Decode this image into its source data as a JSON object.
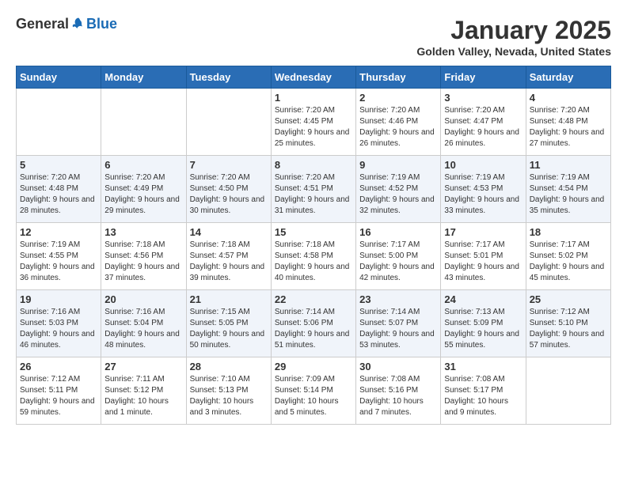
{
  "header": {
    "logo_general": "General",
    "logo_blue": "Blue",
    "title": "January 2025",
    "subtitle": "Golden Valley, Nevada, United States"
  },
  "weekdays": [
    "Sunday",
    "Monday",
    "Tuesday",
    "Wednesday",
    "Thursday",
    "Friday",
    "Saturday"
  ],
  "weeks": [
    [
      {
        "day": "",
        "sunrise": "",
        "sunset": "",
        "daylight": ""
      },
      {
        "day": "",
        "sunrise": "",
        "sunset": "",
        "daylight": ""
      },
      {
        "day": "",
        "sunrise": "",
        "sunset": "",
        "daylight": ""
      },
      {
        "day": "1",
        "sunrise": "Sunrise: 7:20 AM",
        "sunset": "Sunset: 4:45 PM",
        "daylight": "Daylight: 9 hours and 25 minutes."
      },
      {
        "day": "2",
        "sunrise": "Sunrise: 7:20 AM",
        "sunset": "Sunset: 4:46 PM",
        "daylight": "Daylight: 9 hours and 26 minutes."
      },
      {
        "day": "3",
        "sunrise": "Sunrise: 7:20 AM",
        "sunset": "Sunset: 4:47 PM",
        "daylight": "Daylight: 9 hours and 26 minutes."
      },
      {
        "day": "4",
        "sunrise": "Sunrise: 7:20 AM",
        "sunset": "Sunset: 4:48 PM",
        "daylight": "Daylight: 9 hours and 27 minutes."
      }
    ],
    [
      {
        "day": "5",
        "sunrise": "Sunrise: 7:20 AM",
        "sunset": "Sunset: 4:48 PM",
        "daylight": "Daylight: 9 hours and 28 minutes."
      },
      {
        "day": "6",
        "sunrise": "Sunrise: 7:20 AM",
        "sunset": "Sunset: 4:49 PM",
        "daylight": "Daylight: 9 hours and 29 minutes."
      },
      {
        "day": "7",
        "sunrise": "Sunrise: 7:20 AM",
        "sunset": "Sunset: 4:50 PM",
        "daylight": "Daylight: 9 hours and 30 minutes."
      },
      {
        "day": "8",
        "sunrise": "Sunrise: 7:20 AM",
        "sunset": "Sunset: 4:51 PM",
        "daylight": "Daylight: 9 hours and 31 minutes."
      },
      {
        "day": "9",
        "sunrise": "Sunrise: 7:19 AM",
        "sunset": "Sunset: 4:52 PM",
        "daylight": "Daylight: 9 hours and 32 minutes."
      },
      {
        "day": "10",
        "sunrise": "Sunrise: 7:19 AM",
        "sunset": "Sunset: 4:53 PM",
        "daylight": "Daylight: 9 hours and 33 minutes."
      },
      {
        "day": "11",
        "sunrise": "Sunrise: 7:19 AM",
        "sunset": "Sunset: 4:54 PM",
        "daylight": "Daylight: 9 hours and 35 minutes."
      }
    ],
    [
      {
        "day": "12",
        "sunrise": "Sunrise: 7:19 AM",
        "sunset": "Sunset: 4:55 PM",
        "daylight": "Daylight: 9 hours and 36 minutes."
      },
      {
        "day": "13",
        "sunrise": "Sunrise: 7:18 AM",
        "sunset": "Sunset: 4:56 PM",
        "daylight": "Daylight: 9 hours and 37 minutes."
      },
      {
        "day": "14",
        "sunrise": "Sunrise: 7:18 AM",
        "sunset": "Sunset: 4:57 PM",
        "daylight": "Daylight: 9 hours and 39 minutes."
      },
      {
        "day": "15",
        "sunrise": "Sunrise: 7:18 AM",
        "sunset": "Sunset: 4:58 PM",
        "daylight": "Daylight: 9 hours and 40 minutes."
      },
      {
        "day": "16",
        "sunrise": "Sunrise: 7:17 AM",
        "sunset": "Sunset: 5:00 PM",
        "daylight": "Daylight: 9 hours and 42 minutes."
      },
      {
        "day": "17",
        "sunrise": "Sunrise: 7:17 AM",
        "sunset": "Sunset: 5:01 PM",
        "daylight": "Daylight: 9 hours and 43 minutes."
      },
      {
        "day": "18",
        "sunrise": "Sunrise: 7:17 AM",
        "sunset": "Sunset: 5:02 PM",
        "daylight": "Daylight: 9 hours and 45 minutes."
      }
    ],
    [
      {
        "day": "19",
        "sunrise": "Sunrise: 7:16 AM",
        "sunset": "Sunset: 5:03 PM",
        "daylight": "Daylight: 9 hours and 46 minutes."
      },
      {
        "day": "20",
        "sunrise": "Sunrise: 7:16 AM",
        "sunset": "Sunset: 5:04 PM",
        "daylight": "Daylight: 9 hours and 48 minutes."
      },
      {
        "day": "21",
        "sunrise": "Sunrise: 7:15 AM",
        "sunset": "Sunset: 5:05 PM",
        "daylight": "Daylight: 9 hours and 50 minutes."
      },
      {
        "day": "22",
        "sunrise": "Sunrise: 7:14 AM",
        "sunset": "Sunset: 5:06 PM",
        "daylight": "Daylight: 9 hours and 51 minutes."
      },
      {
        "day": "23",
        "sunrise": "Sunrise: 7:14 AM",
        "sunset": "Sunset: 5:07 PM",
        "daylight": "Daylight: 9 hours and 53 minutes."
      },
      {
        "day": "24",
        "sunrise": "Sunrise: 7:13 AM",
        "sunset": "Sunset: 5:09 PM",
        "daylight": "Daylight: 9 hours and 55 minutes."
      },
      {
        "day": "25",
        "sunrise": "Sunrise: 7:12 AM",
        "sunset": "Sunset: 5:10 PM",
        "daylight": "Daylight: 9 hours and 57 minutes."
      }
    ],
    [
      {
        "day": "26",
        "sunrise": "Sunrise: 7:12 AM",
        "sunset": "Sunset: 5:11 PM",
        "daylight": "Daylight: 9 hours and 59 minutes."
      },
      {
        "day": "27",
        "sunrise": "Sunrise: 7:11 AM",
        "sunset": "Sunset: 5:12 PM",
        "daylight": "Daylight: 10 hours and 1 minute."
      },
      {
        "day": "28",
        "sunrise": "Sunrise: 7:10 AM",
        "sunset": "Sunset: 5:13 PM",
        "daylight": "Daylight: 10 hours and 3 minutes."
      },
      {
        "day": "29",
        "sunrise": "Sunrise: 7:09 AM",
        "sunset": "Sunset: 5:14 PM",
        "daylight": "Daylight: 10 hours and 5 minutes."
      },
      {
        "day": "30",
        "sunrise": "Sunrise: 7:08 AM",
        "sunset": "Sunset: 5:16 PM",
        "daylight": "Daylight: 10 hours and 7 minutes."
      },
      {
        "day": "31",
        "sunrise": "Sunrise: 7:08 AM",
        "sunset": "Sunset: 5:17 PM",
        "daylight": "Daylight: 10 hours and 9 minutes."
      },
      {
        "day": "",
        "sunrise": "",
        "sunset": "",
        "daylight": ""
      }
    ]
  ]
}
